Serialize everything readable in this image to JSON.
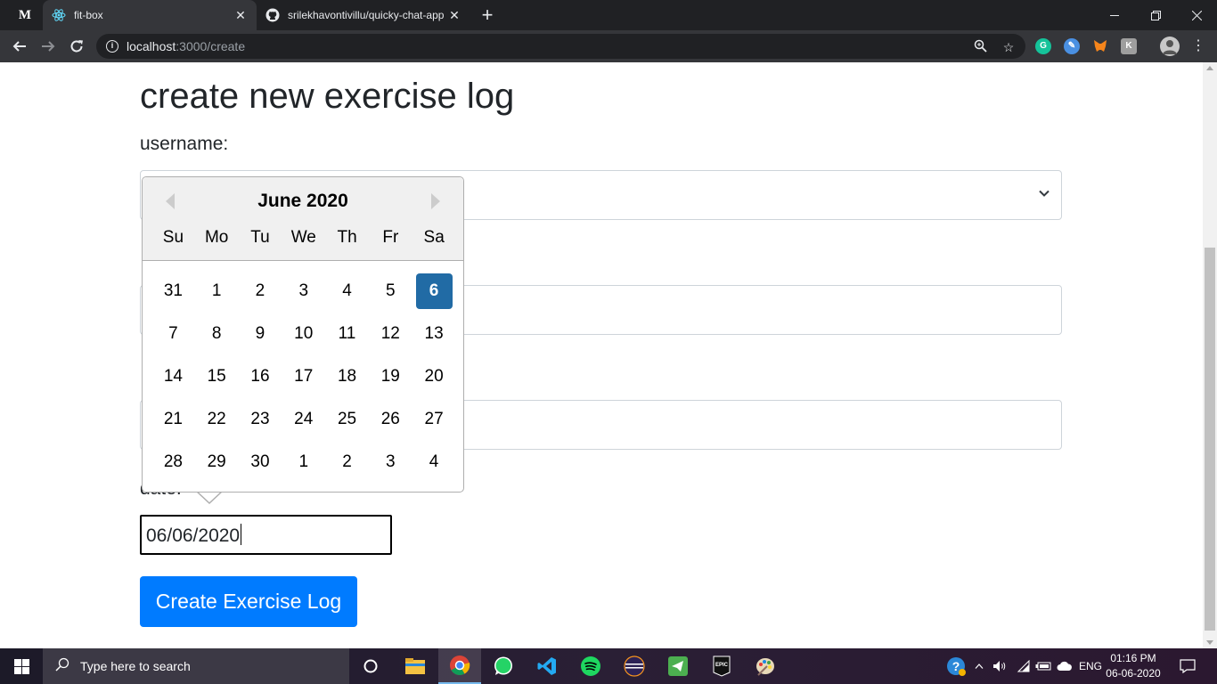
{
  "browser": {
    "tabs": [
      {
        "title": "fit-box",
        "active": true
      },
      {
        "title": "srilekhavontivillu/quicky-chat-app",
        "active": false
      }
    ],
    "pinned_tab_letter": "M",
    "url_host": "localhost",
    "url_path": ":3000/create",
    "new_tab_glyph": "+",
    "close_glyph": "✕"
  },
  "page": {
    "heading": "create new exercise log",
    "username_label": "username:",
    "date_label": "date:",
    "date_value": "06/06/2020",
    "submit_label": "Create Exercise Log"
  },
  "datepicker": {
    "month_label": "June 2020",
    "weekdays": [
      "Su",
      "Mo",
      "Tu",
      "We",
      "Th",
      "Fr",
      "Sa"
    ],
    "weeks": [
      [
        "31",
        "1",
        "2",
        "3",
        "4",
        "5",
        "6"
      ],
      [
        "7",
        "8",
        "9",
        "10",
        "11",
        "12",
        "13"
      ],
      [
        "14",
        "15",
        "16",
        "17",
        "18",
        "19",
        "20"
      ],
      [
        "21",
        "22",
        "23",
        "24",
        "25",
        "26",
        "27"
      ],
      [
        "28",
        "29",
        "30",
        "1",
        "2",
        "3",
        "4"
      ]
    ],
    "selected": "6",
    "selected_color": "#216ba5"
  },
  "taskbar": {
    "search_placeholder": "Type here to search",
    "language": "ENG",
    "time": "01:16 PM",
    "date": "06-06-2020"
  },
  "colors": {
    "primary_button": "#007bff",
    "chrome_dark": "#202124",
    "chrome_toolbar": "#35363a"
  }
}
